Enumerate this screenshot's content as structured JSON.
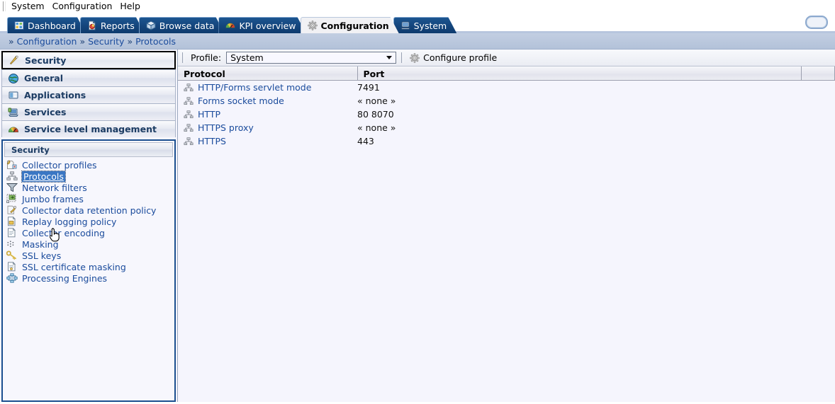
{
  "menubar": {
    "items": [
      {
        "label": "System"
      },
      {
        "label": "Configuration"
      },
      {
        "label": "Help"
      }
    ]
  },
  "tabs": [
    {
      "label": "Dashboard",
      "icon": "dashboard-icon",
      "active": false
    },
    {
      "label": "Reports",
      "icon": "report-icon",
      "active": false
    },
    {
      "label": "Browse data",
      "icon": "cube-icon",
      "active": false
    },
    {
      "label": "KPI overview",
      "icon": "gauge-icon",
      "active": false
    },
    {
      "label": "Configuration",
      "icon": "gear-icon",
      "active": true
    },
    {
      "label": "System",
      "icon": "computer-icon",
      "active": false
    }
  ],
  "window_button": {
    "name": "window-control"
  },
  "breadcrumb": {
    "separator": "»",
    "items": [
      {
        "label": "Configuration"
      },
      {
        "label": "Security"
      },
      {
        "label": "Protocols"
      }
    ]
  },
  "sidebar": {
    "accordion": [
      {
        "label": "Security",
        "icon": "key-feather-icon",
        "selected": true
      },
      {
        "label": "General",
        "icon": "globe-icon",
        "selected": false
      },
      {
        "label": "Applications",
        "icon": "application-icon",
        "selected": false
      },
      {
        "label": "Services",
        "icon": "service-icon",
        "selected": false
      },
      {
        "label": "Service level management",
        "icon": "gauge-icon",
        "selected": false
      }
    ],
    "panel_title": "Security",
    "items": [
      {
        "label": "Collector profiles",
        "icon": "collector-profile-icon",
        "selected": false
      },
      {
        "label": "Protocols",
        "icon": "network-tree-icon",
        "selected": true
      },
      {
        "label": "Network filters",
        "icon": "funnel-icon",
        "selected": false
      },
      {
        "label": "Jumbo frames",
        "icon": "jumbo-frame-icon",
        "selected": false
      },
      {
        "label": "Collector data retention policy",
        "icon": "retention-key-icon",
        "selected": false
      },
      {
        "label": "Replay logging policy",
        "icon": "document-folder-icon",
        "selected": false
      },
      {
        "label": "Collector encoding",
        "icon": "document-encoding-icon",
        "selected": false
      },
      {
        "label": "Masking",
        "icon": "masking-dots-icon",
        "selected": false
      },
      {
        "label": "SSL keys",
        "icon": "key-icon",
        "selected": false
      },
      {
        "label": "SSL certificate masking",
        "icon": "certificate-icon",
        "selected": false
      },
      {
        "label": "Processing Engines",
        "icon": "engines-icon",
        "selected": false
      }
    ]
  },
  "toolbar": {
    "profile_label": "Profile:",
    "profile_value": "System",
    "configure_label": "Configure profile",
    "configure_icon": "gear-icon"
  },
  "table": {
    "columns": [
      {
        "label": "Protocol"
      },
      {
        "label": "Port"
      },
      {
        "label": ""
      }
    ],
    "rows": [
      {
        "protocol": "HTTP/Forms servlet mode",
        "port": "7491",
        "icon": "network-tree-icon"
      },
      {
        "protocol": "Forms socket mode",
        "port": "« none »",
        "icon": "network-tree-icon"
      },
      {
        "protocol": "HTTP",
        "port": "80 8070",
        "icon": "network-tree-icon"
      },
      {
        "protocol": "HTTPS proxy",
        "port": "« none »",
        "icon": "network-tree-icon"
      },
      {
        "protocol": "HTTPS",
        "port": "443",
        "icon": "network-tree-icon"
      }
    ]
  },
  "colors": {
    "tab_active_bg": "#f1f1f4",
    "tab_inactive_bg": "#14457c",
    "breadcrumb_bg": "#b8c6dd",
    "link": "#1a4b9c",
    "selection": "#3b77c4",
    "content_bg": "#f5f5fd",
    "panel_border": "#1b4f8f"
  }
}
